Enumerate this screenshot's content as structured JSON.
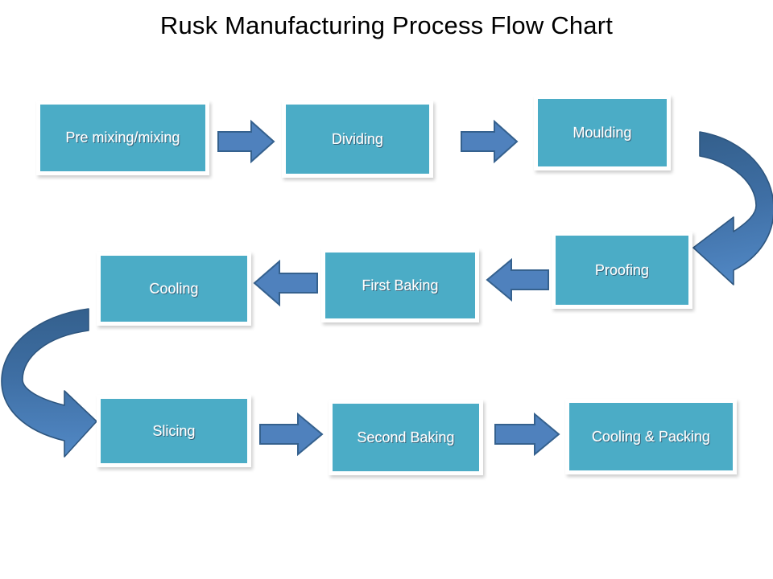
{
  "chart_data": {
    "type": "diagram",
    "diagram_kind": "process-flow-chart",
    "title": "Rusk Manufacturing Process Flow Chart",
    "nodes": [
      {
        "id": "n1",
        "label": "Pre mixing/mixing",
        "row": 1,
        "order": 1
      },
      {
        "id": "n2",
        "label": "Dividing",
        "row": 1,
        "order": 2
      },
      {
        "id": "n3",
        "label": "Moulding",
        "row": 1,
        "order": 3
      },
      {
        "id": "n4",
        "label": "Proofing",
        "row": 2,
        "order": 1
      },
      {
        "id": "n5",
        "label": "First Baking",
        "row": 2,
        "order": 2
      },
      {
        "id": "n6",
        "label": "Cooling",
        "row": 2,
        "order": 3
      },
      {
        "id": "n7",
        "label": "Slicing",
        "row": 3,
        "order": 1
      },
      {
        "id": "n8",
        "label": "Second Baking",
        "row": 3,
        "order": 2
      },
      {
        "id": "n9",
        "label": "Cooling & Packing",
        "row": 3,
        "order": 3
      }
    ],
    "edges": [
      {
        "from": "n1",
        "to": "n2",
        "style": "straight",
        "direction": "right"
      },
      {
        "from": "n2",
        "to": "n3",
        "style": "straight",
        "direction": "right"
      },
      {
        "from": "n3",
        "to": "n4",
        "style": "curved",
        "direction": "down-left"
      },
      {
        "from": "n4",
        "to": "n5",
        "style": "straight",
        "direction": "left"
      },
      {
        "from": "n5",
        "to": "n6",
        "style": "straight",
        "direction": "left"
      },
      {
        "from": "n6",
        "to": "n7",
        "style": "curved",
        "direction": "down-right"
      },
      {
        "from": "n7",
        "to": "n8",
        "style": "straight",
        "direction": "right"
      },
      {
        "from": "n8",
        "to": "n9",
        "style": "straight",
        "direction": "right"
      }
    ],
    "colors": {
      "node_fill": "#4BACC6",
      "node_border": "#FFFFFF",
      "node_text": "#FFFFFF",
      "arrow_fill": "#4F81BD",
      "arrow_stroke": "#35618E",
      "curve_dark": "#35618E",
      "curve_light": "#4E86C4",
      "background": "#FFFFFF",
      "title_text": "#000000"
    }
  },
  "title": {
    "text": "Rusk Manufacturing Process Flow Chart"
  },
  "nodes": {
    "pre_mixing": "Pre mixing/mixing",
    "dividing": "Dividing",
    "moulding": "Moulding",
    "proofing": "Proofing",
    "first_baking": "First Baking",
    "cooling": "Cooling",
    "slicing": "Slicing",
    "second_baking": "Second Baking",
    "cooling_packing": "Cooling & Packing"
  }
}
